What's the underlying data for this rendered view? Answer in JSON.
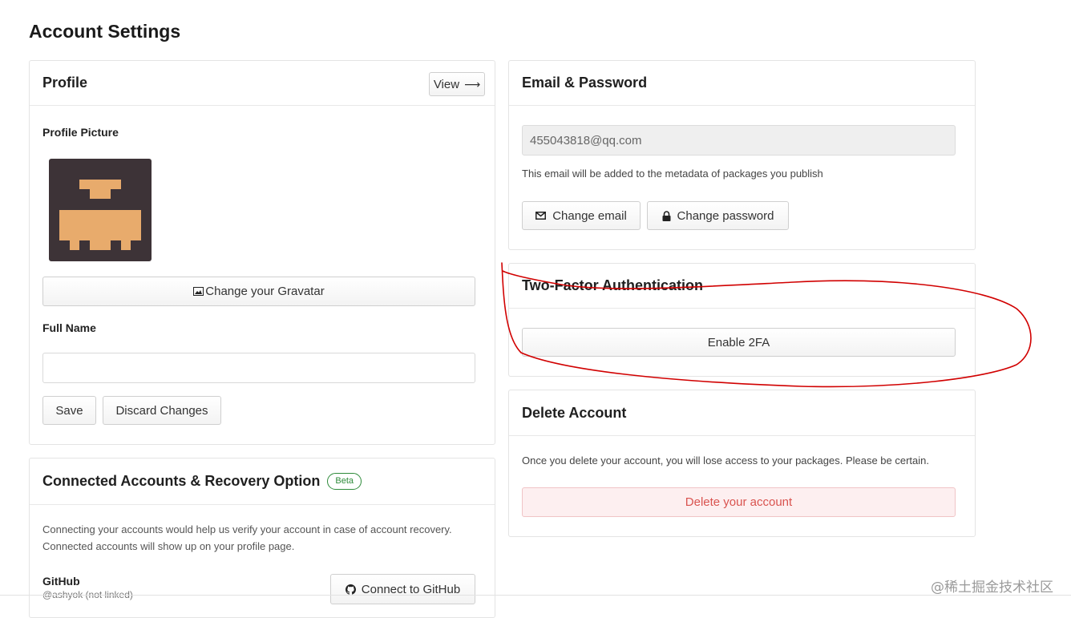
{
  "page": {
    "title": "Account Settings"
  },
  "profile": {
    "title": "Profile",
    "view_label": "View",
    "view_arrow": "⟶",
    "picture_label": "Profile Picture",
    "gravatar_button": "Change your Gravatar",
    "full_name_label": "Full Name",
    "full_name_value": "",
    "save_button": "Save",
    "discard_button": "Discard Changes"
  },
  "connected": {
    "title": "Connected Accounts & Recovery Option",
    "badge": "Beta",
    "description_line1": "Connecting your accounts would help us verify your account in case of account recovery.",
    "description_line2": "Connected accounts will show up on your profile page.",
    "github_label": "GitHub",
    "github_status": "@ashyok (not linked)",
    "connect_button": "Connect to GitHub"
  },
  "email_password": {
    "title": "Email & Password",
    "email_value": "455043818@qq.com",
    "email_note": "This email will be added to the metadata of packages you publish",
    "change_email_button": "Change email",
    "change_password_button": "Change password"
  },
  "two_factor": {
    "title": "Two-Factor Authentication",
    "enable_button": "Enable 2FA"
  },
  "delete_account": {
    "title": "Delete Account",
    "warning": "Once you delete your account, you will lose access to your packages. Please be certain.",
    "delete_button": "Delete your account"
  },
  "watermark": "@稀土掘金技术社区",
  "colors": {
    "avatar_bg": "#3d3337",
    "avatar_fg": "#e8ab6c",
    "annotation_red": "#d10000",
    "beta_green": "#2e8b3a",
    "danger_text": "#d9534f",
    "danger_bg": "#fdeff0"
  },
  "icons": {
    "view": "arrow-right-icon",
    "gravatar": "image-icon",
    "change_email": "envelope-icon",
    "change_password": "lock-icon",
    "github": "github-icon"
  }
}
